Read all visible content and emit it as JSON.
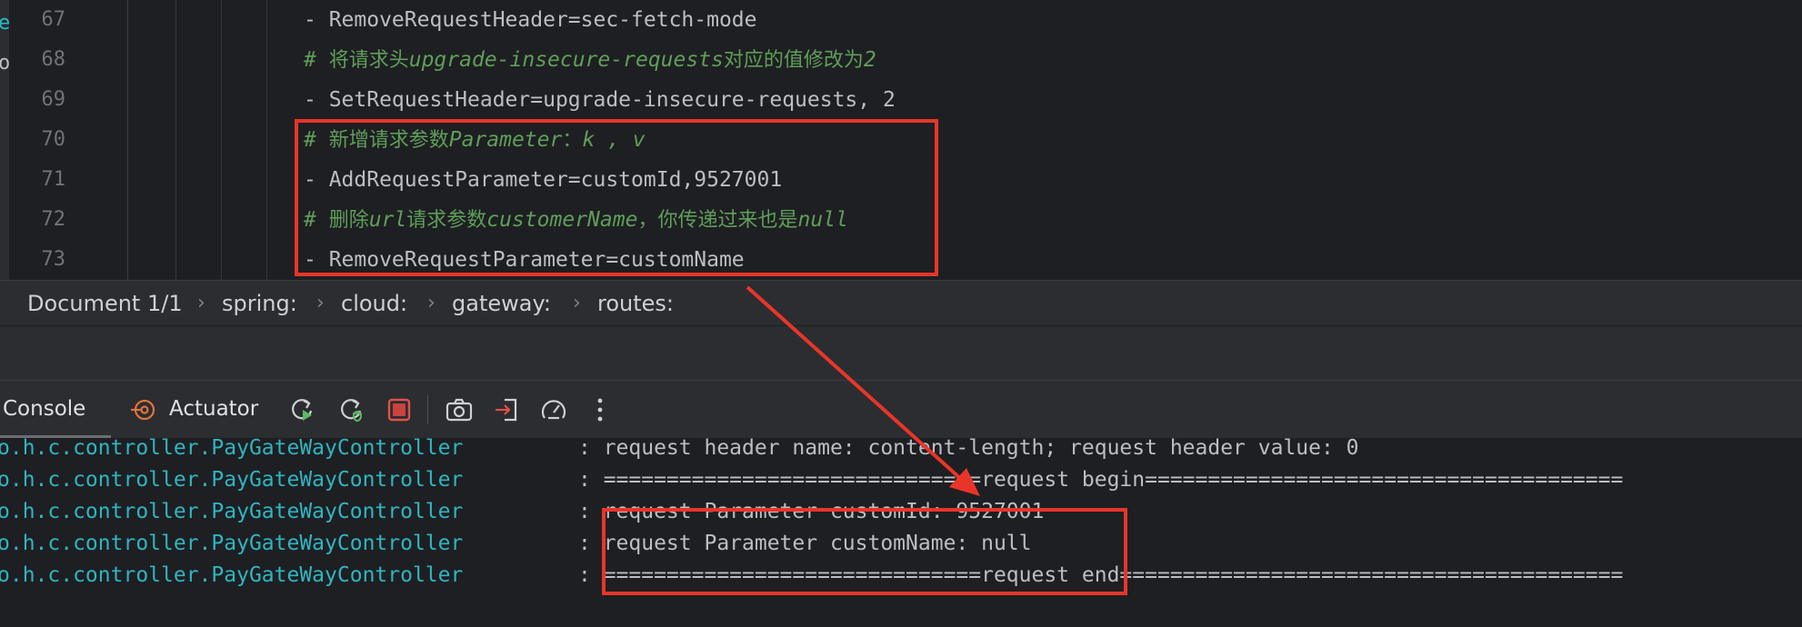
{
  "editor": {
    "left_fragments": [
      "e",
      "o"
    ],
    "lines": [
      {
        "number": "67",
        "kind": "code",
        "segments": [
          {
            "text": "- RemoveRequestHeader=sec-fetch-mode"
          }
        ]
      },
      {
        "number": "68",
        "kind": "comment",
        "segments": [
          {
            "text": "# ",
            "style": "ital"
          },
          {
            "text": "将请求头",
            "style": "cjk"
          },
          {
            "text": "upgrade-insecure-requests",
            "style": "ital"
          },
          {
            "text": "对应的值修改为",
            "style": "cjk"
          },
          {
            "text": "2",
            "style": "ital"
          }
        ]
      },
      {
        "number": "69",
        "kind": "code",
        "segments": [
          {
            "text": "- SetRequestHeader=upgrade-insecure-requests, 2"
          }
        ]
      },
      {
        "number": "70",
        "kind": "comment",
        "segments": [
          {
            "text": "# ",
            "style": "ital"
          },
          {
            "text": "新增请求参数",
            "style": "cjk"
          },
          {
            "text": "Parameter",
            "style": "ital"
          },
          {
            "text": "：",
            "style": "cjk"
          },
          {
            "text": "k , v",
            "style": "ital"
          }
        ]
      },
      {
        "number": "71",
        "kind": "code",
        "segments": [
          {
            "text": "- AddRequestParameter=customId,9527001"
          }
        ]
      },
      {
        "number": "72",
        "kind": "comment",
        "segments": [
          {
            "text": "# ",
            "style": "ital"
          },
          {
            "text": "删除",
            "style": "cjk"
          },
          {
            "text": "url",
            "style": "ital"
          },
          {
            "text": "请求参数",
            "style": "cjk"
          },
          {
            "text": "customerName",
            "style": "ital"
          },
          {
            "text": "，你传递过来也是",
            "style": "cjk"
          },
          {
            "text": "null",
            "style": "ital"
          }
        ]
      },
      {
        "number": "73",
        "kind": "code",
        "segments": [
          {
            "text": "- RemoveRequestParameter=customName"
          }
        ]
      }
    ]
  },
  "breadcrumb": {
    "items": [
      "Document 1/1",
      "spring:",
      "cloud:",
      "gateway:",
      "routes:"
    ],
    "separator": "›"
  },
  "toolbar": {
    "tabs": [
      {
        "label": "Console",
        "icon": null,
        "active": true
      },
      {
        "label": "Actuator",
        "icon": "actuator-icon",
        "active": false
      }
    ],
    "actions": [
      {
        "icon": "rerun-icon"
      },
      {
        "icon": "rerun-debug-icon"
      },
      {
        "icon": "stop-icon"
      },
      {
        "icon": "camera-icon"
      },
      {
        "icon": "login-icon"
      },
      {
        "icon": "speedometer-icon"
      },
      {
        "icon": "more-options-icon"
      }
    ]
  },
  "console": {
    "lines": [
      {
        "logger": "o.h.c.controller.PayGateWayController",
        "message": ": request header name: content-length; request header value: 0"
      },
      {
        "logger": "o.h.c.controller.PayGateWayController",
        "message": ": ==============================request begin======================================"
      },
      {
        "logger": "o.h.c.controller.PayGateWayController",
        "message": ": request Parameter customId: 9527001"
      },
      {
        "logger": "o.h.c.controller.PayGateWayController",
        "message": ": request Parameter customName: null"
      },
      {
        "logger": "o.h.c.controller.PayGateWayController",
        "message": ": ==============================request end========================================"
      }
    ]
  },
  "colors": {
    "highlight": "#e8352a",
    "comment": "#5f9e5a",
    "logger": "#2fb5c1",
    "code": "#bcbec4",
    "editor_bg": "#1e1f22",
    "panel_bg": "#2b2d30"
  }
}
